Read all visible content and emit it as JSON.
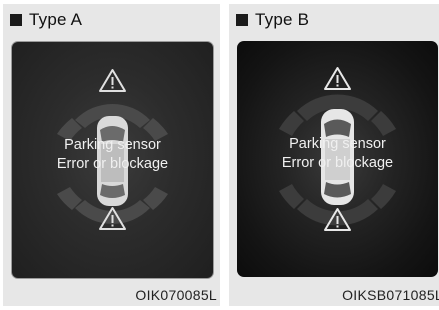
{
  "panels": [
    {
      "title": "Type A",
      "message_line1": "Parking sensor",
      "message_line2": "Error or blockage",
      "code": "OIK070085L"
    },
    {
      "title": "Type B",
      "message_line1": "Parking sensor",
      "message_line2": "Error or blockage",
      "code": "OIKSB071085L"
    }
  ],
  "icons": {
    "warning": "warning-triangle-icon",
    "car": "car-top-view-icon"
  },
  "colors": {
    "panel_bg": "#e7e7e7",
    "screen_bg": "#1f1f1f",
    "text": "#f0f0f0"
  }
}
